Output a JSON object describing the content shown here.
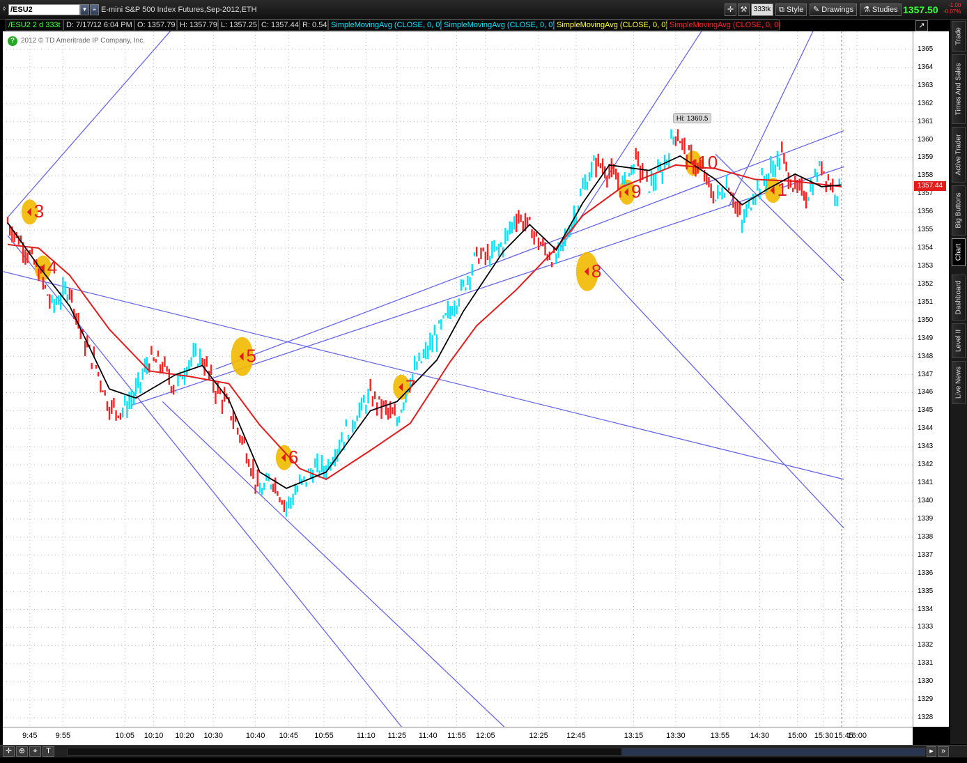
{
  "toolbar": {
    "symbol": "/ESU2",
    "description": "E-mini S&P 500 Index Futures,Sep-2012,ETH",
    "aggregation": "333tk",
    "style_label": "Style",
    "drawings_label": "Drawings",
    "studies_label": "Studies",
    "last_price": "1357.50",
    "change": "-1.00",
    "change_pct": "-0.07%"
  },
  "infobar": {
    "symbol": "/ESU2 2 d 333t",
    "date": "D: 7/17/12 6:04 PM",
    "open": "O: 1357.79",
    "high": "H: 1357.79",
    "low": "L: 1357.25",
    "close": "C: 1357.44",
    "range": "R: 0.54",
    "studies": [
      {
        "label": "SimpleMovingAvg (CLOSE, 0, 0)",
        "color": "#00e5ff"
      },
      {
        "label": "SimpleMovingAvg (CLOSE, 0, 0)",
        "color": "#00e5ff"
      },
      {
        "label": "SimpleMovingAvg (CLOSE, 0, 0)",
        "color": "#ffff33"
      },
      {
        "label": "SimpleMovingAvg (CLOSE, 0, 0)",
        "color": "#ff2020"
      }
    ]
  },
  "copyright": "2012 © TD Ameritrade IP Company, Inc.",
  "side_tabs": [
    "Trade",
    "Times And Sales",
    "Active Trader",
    "Big Buttons",
    "Chart",
    "Dashboard",
    "Level II",
    "Live News"
  ],
  "colors": {
    "up_bar": "#00e5ff",
    "down_bar": "#ff2020",
    "sma_fast": "#000000",
    "sma_slow": "#e31b1b",
    "trendline": "#6666ee",
    "marker": "#f2b800"
  },
  "chart_data": {
    "type": "line",
    "title": "",
    "ylim": [
      1327.5,
      1366
    ],
    "yticks": [
      1328,
      1329,
      1330,
      1331,
      1332,
      1333,
      1334,
      1335,
      1336,
      1337,
      1338,
      1339,
      1340,
      1341,
      1342,
      1343,
      1344,
      1345,
      1346,
      1347,
      1348,
      1349,
      1350,
      1351,
      1352,
      1353,
      1354,
      1355,
      1356,
      1357,
      1358,
      1359,
      1360,
      1361,
      1362,
      1363,
      1364,
      1365
    ],
    "xticks": [
      "9:45",
      "9:55",
      "10:05",
      "10:10",
      "10:20",
      "10:30",
      "10:40",
      "10:45",
      "10:55",
      "11:10",
      "11:25",
      "11:40",
      "11:55",
      "12:05",
      "12:25",
      "12:45",
      "13:15",
      "13:30",
      "13:55",
      "14:30",
      "15:00",
      "15:30",
      "15:45",
      "16:00"
    ],
    "last_price_label": "1357.44",
    "last_price": 1357.44,
    "high_label": "Hi: 1360.5",
    "high": 1360.5,
    "price_path": [
      [
        0,
        1355.4
      ],
      [
        8,
        1354
      ],
      [
        14,
        1352.7
      ],
      [
        20,
        1350.8
      ],
      [
        28,
        1351.8
      ],
      [
        34,
        1349
      ],
      [
        40,
        1347.5
      ],
      [
        46,
        1345.2
      ],
      [
        52,
        1345
      ],
      [
        58,
        1346
      ],
      [
        64,
        1347.8
      ],
      [
        70,
        1347.5
      ],
      [
        76,
        1346.2
      ],
      [
        82,
        1347.8
      ],
      [
        88,
        1347.9
      ],
      [
        94,
        1346.2
      ],
      [
        100,
        1345.2
      ],
      [
        108,
        1342.8
      ],
      [
        114,
        1340.4
      ],
      [
        120,
        1341.2
      ],
      [
        126,
        1339.7
      ],
      [
        132,
        1340.8
      ],
      [
        138,
        1341.7
      ],
      [
        144,
        1341.8
      ],
      [
        150,
        1343.2
      ],
      [
        158,
        1344.8
      ],
      [
        164,
        1345.8
      ],
      [
        170,
        1345.2
      ],
      [
        176,
        1344.4
      ],
      [
        182,
        1346.8
      ],
      [
        188,
        1347.9
      ],
      [
        194,
        1349.2
      ],
      [
        200,
        1350.5
      ],
      [
        206,
        1351.8
      ],
      [
        212,
        1353.6
      ],
      [
        218,
        1353.5
      ],
      [
        224,
        1354.2
      ],
      [
        230,
        1355.8
      ],
      [
        236,
        1355.2
      ],
      [
        242,
        1354
      ],
      [
        248,
        1353.3
      ],
      [
        254,
        1355.1
      ],
      [
        260,
        1357.2
      ],
      [
        266,
        1358.8
      ],
      [
        272,
        1358.2
      ],
      [
        278,
        1357.4
      ],
      [
        284,
        1358.9
      ],
      [
        290,
        1357.5
      ],
      [
        296,
        1358.2
      ],
      [
        302,
        1360.5
      ],
      [
        308,
        1359
      ],
      [
        314,
        1358.2
      ],
      [
        320,
        1356.7
      ],
      [
        326,
        1357.6
      ],
      [
        332,
        1355.3
      ],
      [
        338,
        1357.2
      ],
      [
        344,
        1358.1
      ],
      [
        350,
        1359.1
      ],
      [
        356,
        1357.2
      ],
      [
        362,
        1357
      ],
      [
        368,
        1358.6
      ],
      [
        374,
        1357.1
      ],
      [
        377,
        1357.44
      ]
    ],
    "sma_fast": [
      [
        0,
        1355.4
      ],
      [
        14,
        1353
      ],
      [
        28,
        1350.8
      ],
      [
        46,
        1346.2
      ],
      [
        58,
        1345.7
      ],
      [
        76,
        1347
      ],
      [
        88,
        1347.5
      ],
      [
        100,
        1345.6
      ],
      [
        114,
        1341.6
      ],
      [
        126,
        1340.7
      ],
      [
        144,
        1341.6
      ],
      [
        164,
        1345
      ],
      [
        176,
        1345.5
      ],
      [
        194,
        1347.8
      ],
      [
        206,
        1350.5
      ],
      [
        224,
        1353.8
      ],
      [
        236,
        1355.3
      ],
      [
        248,
        1353.9
      ],
      [
        260,
        1356.5
      ],
      [
        272,
        1358.6
      ],
      [
        290,
        1358.3
      ],
      [
        304,
        1359.1
      ],
      [
        320,
        1357.8
      ],
      [
        332,
        1356.4
      ],
      [
        344,
        1357.3
      ],
      [
        356,
        1358.1
      ],
      [
        368,
        1357.4
      ],
      [
        377,
        1357.5
      ]
    ],
    "sma_slow": [
      [
        0,
        1354.2
      ],
      [
        14,
        1354
      ],
      [
        28,
        1352.5
      ],
      [
        46,
        1349.5
      ],
      [
        64,
        1347.2
      ],
      [
        82,
        1346.9
      ],
      [
        100,
        1346.5
      ],
      [
        114,
        1344.2
      ],
      [
        132,
        1341.8
      ],
      [
        144,
        1341.2
      ],
      [
        164,
        1342.8
      ],
      [
        182,
        1344.3
      ],
      [
        200,
        1347.7
      ],
      [
        212,
        1349.7
      ],
      [
        230,
        1351.7
      ],
      [
        248,
        1354
      ],
      [
        260,
        1355.8
      ],
      [
        278,
        1357.4
      ],
      [
        302,
        1358.6
      ],
      [
        320,
        1358.4
      ],
      [
        338,
        1357.8
      ],
      [
        356,
        1357.7
      ],
      [
        377,
        1357.4
      ]
    ],
    "trendlines": [
      {
        "from": [
          0,
          1355.7
        ],
        "to": [
          82,
          1367.2
        ]
      },
      {
        "from": [
          0,
          1354.7
        ],
        "to": [
          180,
          1327.2
        ]
      },
      {
        "from": [
          70,
          1345.5
        ],
        "to": [
          227,
          1327.2
        ]
      },
      {
        "from": [
          -2,
          1352.7
        ],
        "to": [
          378,
          1341.2
        ]
      },
      {
        "from": [
          56,
          1345.3
        ],
        "to": [
          378,
          1358.5
        ]
      },
      {
        "from": [
          94,
          1347.3
        ],
        "to": [
          378,
          1360.5
        ]
      },
      {
        "from": [
          250,
          1354
        ],
        "to": [
          320,
          1367.2
        ]
      },
      {
        "from": [
          266,
          1353.2
        ],
        "to": [
          378,
          1338.5
        ]
      },
      {
        "from": [
          320,
          1359.2
        ],
        "to": [
          378,
          1352.2
        ]
      },
      {
        "from": [
          326,
          1356.3
        ],
        "to": [
          366,
          1366.5
        ]
      }
    ],
    "markers": [
      {
        "label": "3",
        "x": 10,
        "y": 1356
      },
      {
        "label": "4",
        "x": 16,
        "y": 1352.9
      },
      {
        "label": "5",
        "x": 106,
        "y": 1348
      },
      {
        "label": "6",
        "x": 125,
        "y": 1342.4
      },
      {
        "label": "7",
        "x": 178,
        "y": 1346.3
      },
      {
        "label": "8",
        "x": 262,
        "y": 1352.7
      },
      {
        "label": "9",
        "x": 280,
        "y": 1357.1
      },
      {
        "label": "10",
        "x": 310,
        "y": 1358.7
      },
      {
        "label": "1",
        "x": 346,
        "y": 1357.2
      }
    ],
    "x_ticks_pos": [
      10,
      25,
      53,
      66,
      80,
      93,
      112,
      127,
      143,
      162,
      176,
      190,
      203,
      216,
      240,
      257,
      283,
      302,
      322,
      340,
      357,
      369,
      378,
      384
    ]
  }
}
